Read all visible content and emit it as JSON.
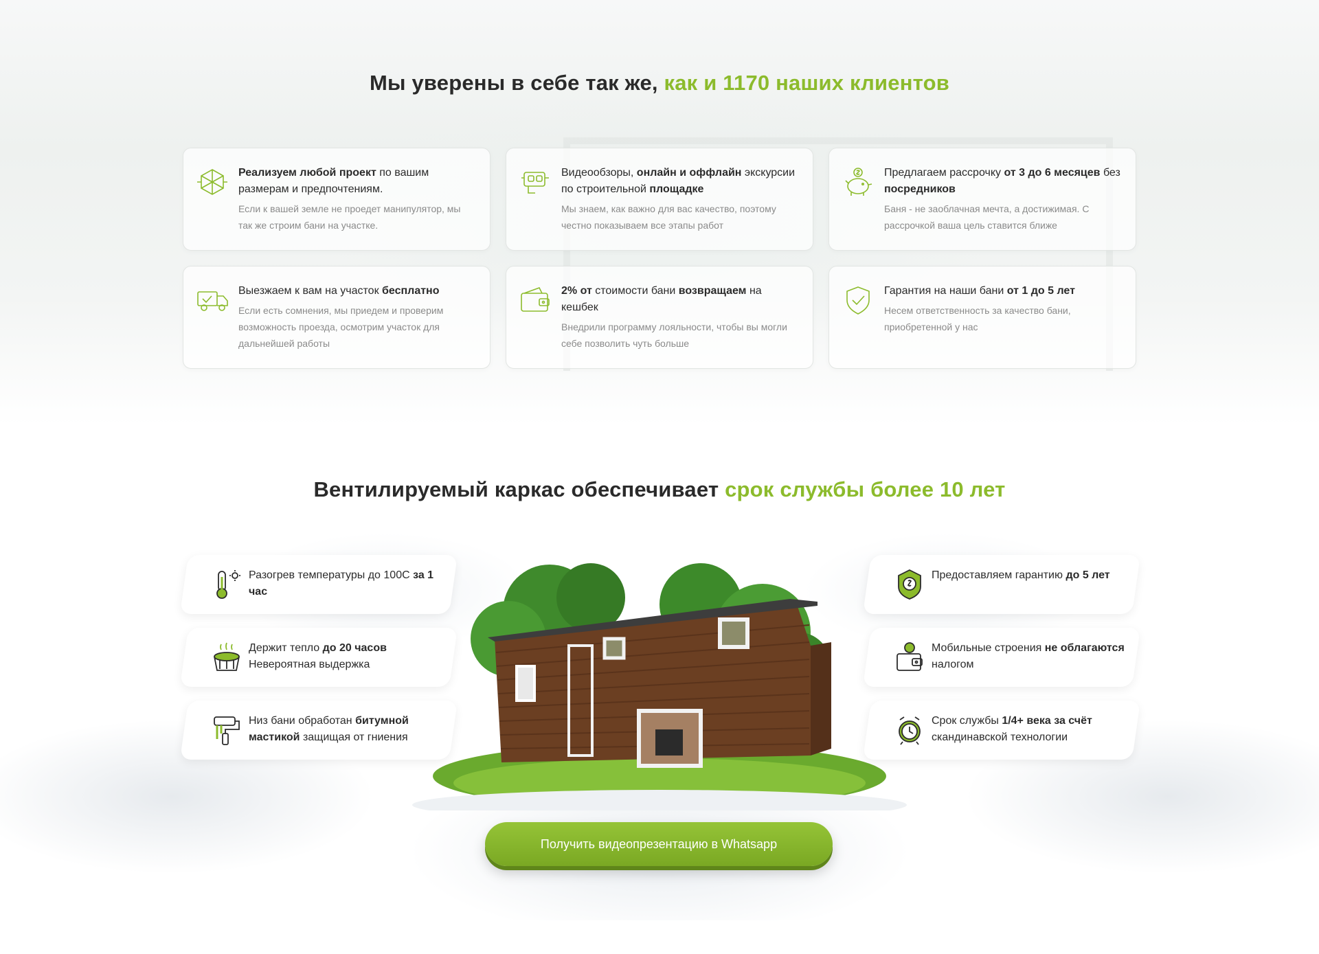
{
  "section1": {
    "title_main": "Мы уверены в себе так же, ",
    "title_accent": "как и 1170 наших клиентов",
    "cards": [
      {
        "icon": "cube-icon",
        "title_parts": [
          [
            "b",
            "Реализуем любой проект"
          ],
          [
            "t",
            " по вашим размерам и предпочтениям."
          ]
        ],
        "desc": "Если к вашей земле не проедет манипулятор, мы так же строим бани на участке."
      },
      {
        "icon": "vr-headset-icon",
        "title_parts": [
          [
            "t",
            "Видеообзоры, "
          ],
          [
            "b",
            "онлайн и оффлайн"
          ],
          [
            "t",
            " экскурсии по строительной "
          ],
          [
            "b",
            "площадке"
          ]
        ],
        "desc": "Мы знаем, как важно для вас качество, поэтому  честно показываем все этапы работ"
      },
      {
        "icon": "piggy-bank-icon",
        "title_parts": [
          [
            "t",
            "Предлагаем рассрочку "
          ],
          [
            "b",
            "от 3 до 6 месяцев"
          ],
          [
            "t",
            " без "
          ],
          [
            "b",
            "посредников"
          ]
        ],
        "desc": "Баня - не заоблачная мечта, а достижимая. С рассрочкой ваша цель ставится ближе"
      },
      {
        "icon": "delivery-truck-icon",
        "title_parts": [
          [
            "t",
            "Выезжаем к вам на участок "
          ],
          [
            "b",
            "бесплатно"
          ]
        ],
        "desc": "Если есть сомнения, мы приедем и проверим возможность проезда, осмотрим участок для дальнейшей работы"
      },
      {
        "icon": "wallet-icon",
        "title_parts": [
          [
            "b",
            "2% от"
          ],
          [
            "t",
            " стоимости бани "
          ],
          [
            "b",
            "возвращаем"
          ],
          [
            "t",
            " на кешбек"
          ]
        ],
        "desc": "Внедрили программу лояльности, чтобы вы могли себе позволить чуть больше"
      },
      {
        "icon": "shield-check-icon",
        "title_parts": [
          [
            "t",
            "Гарантия на наши бани "
          ],
          [
            "b",
            "от 1 до 5 лет"
          ]
        ],
        "desc": "Несем ответственность за качество бани, приобретенной у нас"
      }
    ]
  },
  "section2": {
    "title_main": "Вентилируемый каркас обеспечивает ",
    "title_accent": "срок службы более 10 лет",
    "features_left": [
      {
        "icon": "thermometer-icon",
        "parts": [
          [
            "t",
            "Разогрев температуры до 100С "
          ],
          [
            "b",
            "за 1 час"
          ]
        ]
      },
      {
        "icon": "sauna-stones-icon",
        "parts": [
          [
            "t",
            "Держит тепло "
          ],
          [
            "b",
            "до 20 часов"
          ],
          [
            "t",
            " Невероятная выдержка"
          ]
        ]
      },
      {
        "icon": "paint-roller-icon",
        "parts": [
          [
            "t",
            "Низ бани обработан "
          ],
          [
            "b",
            "битумной мастикой"
          ],
          [
            "t",
            " защищая от гниения"
          ]
        ]
      }
    ],
    "features_right": [
      {
        "icon": "guarantee-badge-icon",
        "parts": [
          [
            "t",
            "Предоставляем гарантию "
          ],
          [
            "b",
            "до 5 лет"
          ]
        ]
      },
      {
        "icon": "tax-wallet-icon",
        "parts": [
          [
            "t",
            "Мобильные строения "
          ],
          [
            "b",
            "не облагаются"
          ],
          [
            "t",
            " налогом"
          ]
        ]
      },
      {
        "icon": "alarm-clock-icon",
        "parts": [
          [
            "t",
            "Срок службы "
          ],
          [
            "b",
            "1/4+ века за счёт"
          ],
          [
            "t",
            " скандинавской технологии"
          ]
        ]
      }
    ],
    "cta_label": "Получить видеопрезентацию в Whatsapp"
  },
  "colors": {
    "accent": "#8cbb2c",
    "text": "#2b2b2b",
    "muted": "#8a8a8a",
    "button": "#84b22b"
  }
}
